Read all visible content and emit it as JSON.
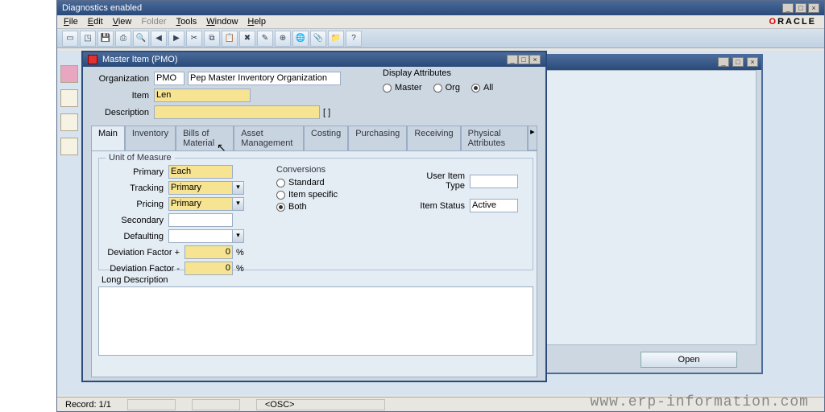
{
  "outer_window": {
    "title": "Diagnostics enabled"
  },
  "menubar": [
    "File",
    "Edit",
    "View",
    "Folder",
    "Tools",
    "Window",
    "Help"
  ],
  "brand": "ORACLE",
  "child_window": {
    "title": "Master Item (PMO)",
    "organization_label": "Organization",
    "organization_code": "PMO",
    "organization_name": "Pep Master Inventory Organization",
    "item_label": "Item",
    "item_value": "Len",
    "description_label": "Description",
    "description_value": "",
    "display_attributes_label": "Display Attributes",
    "display_options": {
      "master": "Master",
      "org": "Org",
      "all": "All",
      "selected": "All"
    },
    "tabs": [
      "Main",
      "Inventory",
      "Bills of Material",
      "Asset Management",
      "Costing",
      "Purchasing",
      "Receiving",
      "Physical Attributes"
    ],
    "active_tab": "Main",
    "uom": {
      "group_label": "Unit of Measure",
      "primary_label": "Primary",
      "primary_value": "Each",
      "tracking_label": "Tracking",
      "tracking_value": "Primary",
      "pricing_label": "Pricing",
      "pricing_value": "Primary",
      "secondary_label": "Secondary",
      "secondary_value": "",
      "defaulting_label": "Defaulting",
      "defaulting_value": "",
      "dev_plus_label": "Deviation Factor +",
      "dev_plus_value": "0",
      "pct": "%",
      "dev_minus_label": "Deviation Factor -",
      "dev_minus_value": "0"
    },
    "conversions": {
      "label": "Conversions",
      "standard": "Standard",
      "item_specific": "Item specific",
      "both": "Both",
      "selected": "Both"
    },
    "user_item_type_label": "User Item Type",
    "user_item_type_value": "",
    "item_status_label": "Item Status",
    "item_status_value": "Active",
    "long_desc_label": "Long Description",
    "long_desc_value": ""
  },
  "bg_window": {
    "open_label": "Open"
  },
  "footer": {
    "record_label": "Record: 1/1",
    "osc": "<OSC>"
  },
  "watermark": "www.erp-information.com"
}
